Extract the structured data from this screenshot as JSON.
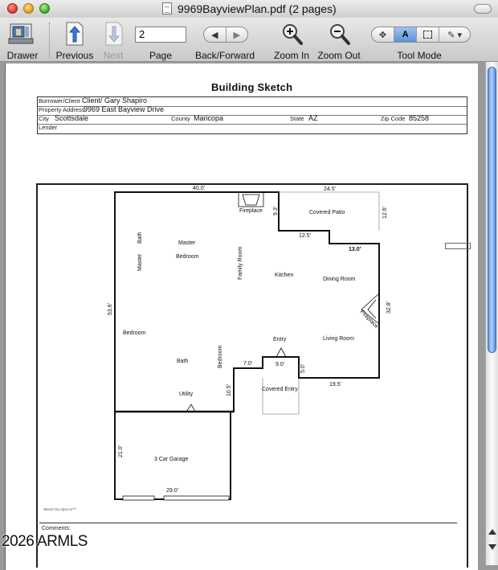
{
  "window": {
    "title": "9969BayviewPlan.pdf (2 pages)"
  },
  "toolbar": {
    "drawer": "Drawer",
    "previous": "Previous",
    "next": "Next",
    "page_label": "Page",
    "page_value": "2",
    "back_forward": "Back/Forward",
    "zoom_in": "Zoom In",
    "zoom_out": "Zoom Out",
    "tool_mode": "Tool Mode",
    "text_tool": "A"
  },
  "document": {
    "title": "Building Sketch",
    "fields": {
      "borrower_label": "Borrower/Client",
      "borrower_value": "Client/ Gary Shapiro",
      "address_label": "Property Address",
      "address_value": "9969 East Bayview Drive",
      "city_label": "City",
      "city_value": "Scottsdale",
      "county_label": "County",
      "county_value": "Maricopa",
      "state_label": "State",
      "state_value": "AZ",
      "zip_label": "Zip Code",
      "zip_value": "85258",
      "lender_label": "Lender"
    },
    "plan": {
      "dims": {
        "top": "40.0'",
        "patio_top": "24.5'",
        "patio_side": "12.6'",
        "fireplace_drop": "9.3'",
        "step": "12.5'",
        "step_right": "13.0'",
        "right": "32.8'",
        "left": "53.6'",
        "entry_width": "9.0'",
        "entry_step": "7.0'",
        "entry_side": "5.0'",
        "bottom_right": "19.5'",
        "utility_side": "10.5'",
        "garage_side": "21.0'",
        "garage_bottom": "29.0'"
      },
      "rooms": {
        "fireplace": "Fireplace",
        "covered_patio": "Covered Patio",
        "master": "Master",
        "bedroom": "Bedroom",
        "master_bath_a": "Master",
        "master_bath_b": "Bath",
        "family_room": "Family Room",
        "kitchen": "Kitchen",
        "dining_room": "Dining Room",
        "fireplace2": "Fireplace",
        "bedroom_left": "Bedroom",
        "entry": "Entry",
        "living_room": "Living Room",
        "bath": "Bath",
        "bedroom_vert": "Bedroom",
        "utility": "Utility",
        "covered_entry": "Covered Entry",
        "garage": "3 Car Garage"
      }
    },
    "sketch_by": "Sketch by Apex IV™",
    "comments_label": "Comments:"
  },
  "watermark": "2026 ARMLS"
}
